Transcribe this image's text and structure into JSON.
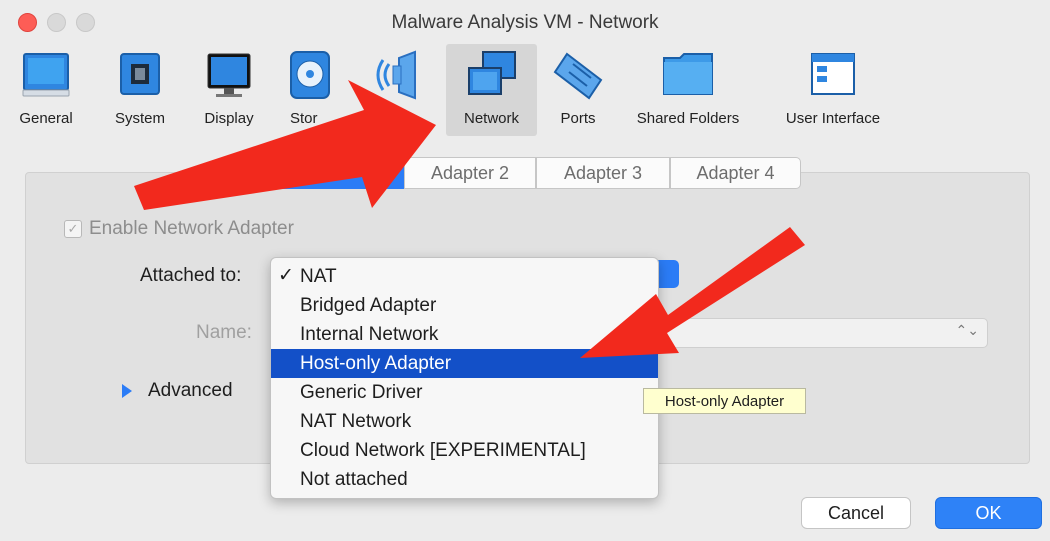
{
  "window": {
    "title": "Malware Analysis VM - Network"
  },
  "toolbar": {
    "items": [
      {
        "label": "General",
        "icon": "general-icon"
      },
      {
        "label": "System",
        "icon": "system-icon"
      },
      {
        "label": "Display",
        "icon": "display-icon"
      },
      {
        "label": "Stor",
        "icon": "storage-icon"
      },
      {
        "label": "",
        "icon": "audio-icon"
      },
      {
        "label": "Network",
        "icon": "network-icon",
        "selected": true
      },
      {
        "label": "Ports",
        "icon": "ports-icon"
      },
      {
        "label": "Shared Folders",
        "icon": "shared-folders-icon"
      },
      {
        "label": "User Interface",
        "icon": "user-interface-icon"
      }
    ]
  },
  "tabs": [
    {
      "label": "",
      "active": true
    },
    {
      "label": "Adapter 2"
    },
    {
      "label": "Adapter 3"
    },
    {
      "label": "Adapter 4"
    }
  ],
  "adapter": {
    "enable_label": "Enable Network Adapter",
    "enable_checked": true,
    "attached_label": "Attached to:",
    "name_label": "Name:",
    "advanced_label": "Advanced"
  },
  "dropdown": {
    "selected": "NAT",
    "highlighted": "Host-only Adapter",
    "check_mark": "✓",
    "options": [
      "NAT",
      "Bridged Adapter",
      "Internal Network",
      "Host-only Adapter",
      "Generic Driver",
      "NAT Network",
      "Cloud Network [EXPERIMENTAL]",
      "Not attached"
    ]
  },
  "tooltip": {
    "text": "Host-only Adapter"
  },
  "buttons": {
    "cancel": "Cancel",
    "ok": "OK"
  },
  "colors": {
    "accent": "#2b7cf6",
    "highlight": "#1350c8",
    "annotation_arrow": "#f2291d"
  }
}
